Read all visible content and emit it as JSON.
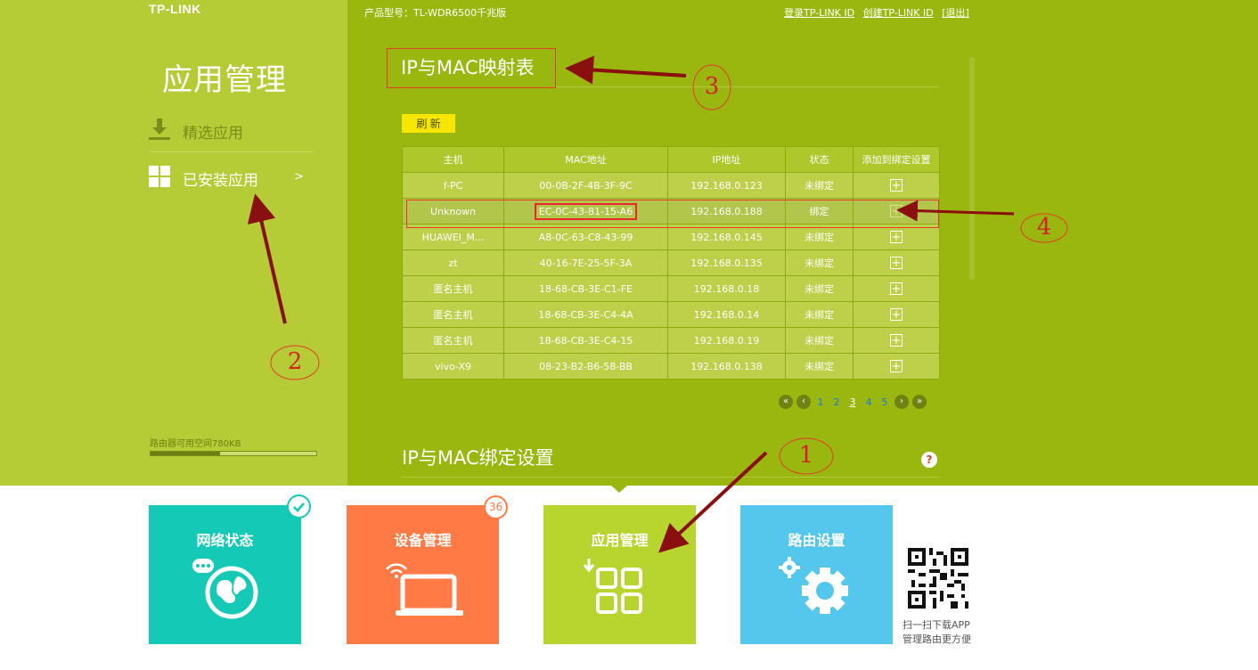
{
  "brand": {
    "logo": "TP-LINK"
  },
  "header": {
    "model_label": "产品型号：TL-WDR6500千兆版",
    "login_link": "登录TP-LINK ID",
    "create_link": "创建TP-LINK ID",
    "logout_link": "[退出]"
  },
  "sidebar": {
    "title": "应用管理",
    "items": [
      {
        "label": "精选应用",
        "icon": "download-icon"
      },
      {
        "label": "已安装应用",
        "icon": "grid-icon",
        "chevron": ">"
      }
    ],
    "storage_label": "路由器可用空间780KB",
    "storage_used_fraction": 0.42
  },
  "map_section": {
    "title": "IP与MAC映射表",
    "refresh_label": "刷 新",
    "columns": [
      "主机",
      "MAC地址",
      "IP地址",
      "状态",
      "添加到绑定设置"
    ],
    "rows": [
      {
        "host": "f-PC",
        "mac": "00-0B-2F-4B-3F-9C",
        "ip": "192.168.0.123",
        "status": "未绑定"
      },
      {
        "host": "Unknown",
        "mac": "EC-0C-43-81-15-A6",
        "ip": "192.168.0.188",
        "status": "绑定"
      },
      {
        "host": "HUAWEI_M...",
        "mac": "A8-0C-63-C8-43-99",
        "ip": "192.168.0.145",
        "status": "未绑定"
      },
      {
        "host": "zt",
        "mac": "40-16-7E-25-5F-3A",
        "ip": "192.168.0.135",
        "status": "未绑定"
      },
      {
        "host": "匿名主机",
        "mac": "18-68-CB-3E-C1-FE",
        "ip": "192.168.0.18",
        "status": "未绑定"
      },
      {
        "host": "匿名主机",
        "mac": "18-68-CB-3E-C4-4A",
        "ip": "192.168.0.14",
        "status": "未绑定"
      },
      {
        "host": "匿名主机",
        "mac": "18-68-CB-3E-C4-15",
        "ip": "192.168.0.19",
        "status": "未绑定"
      },
      {
        "host": "vivo-X9",
        "mac": "08-23-B2-B6-58-BB",
        "ip": "192.168.0.138",
        "status": "未绑定"
      }
    ],
    "pager": {
      "pages": [
        "1",
        "2",
        "3",
        "4",
        "5"
      ],
      "current": "3"
    }
  },
  "bind_section": {
    "title": "IP与MAC绑定设置",
    "help": "?"
  },
  "tiles": [
    {
      "label": "网络状态",
      "icon": "globe-icon",
      "color": "#14c9b5"
    },
    {
      "label": "设备管理",
      "icon": "laptop-icon",
      "color": "#ff7a45",
      "badge": "36"
    },
    {
      "label": "应用管理",
      "icon": "apps-grid-icon",
      "color": "#b7d52e"
    },
    {
      "label": "路由设置",
      "icon": "gear-icon",
      "color": "#55c7ec"
    }
  ],
  "qr": {
    "line1": "扫一扫下载APP",
    "line2": "管理路由更方便"
  },
  "annotations": {
    "a1": "1",
    "a2": "2",
    "a3": "3",
    "a4": "4"
  }
}
